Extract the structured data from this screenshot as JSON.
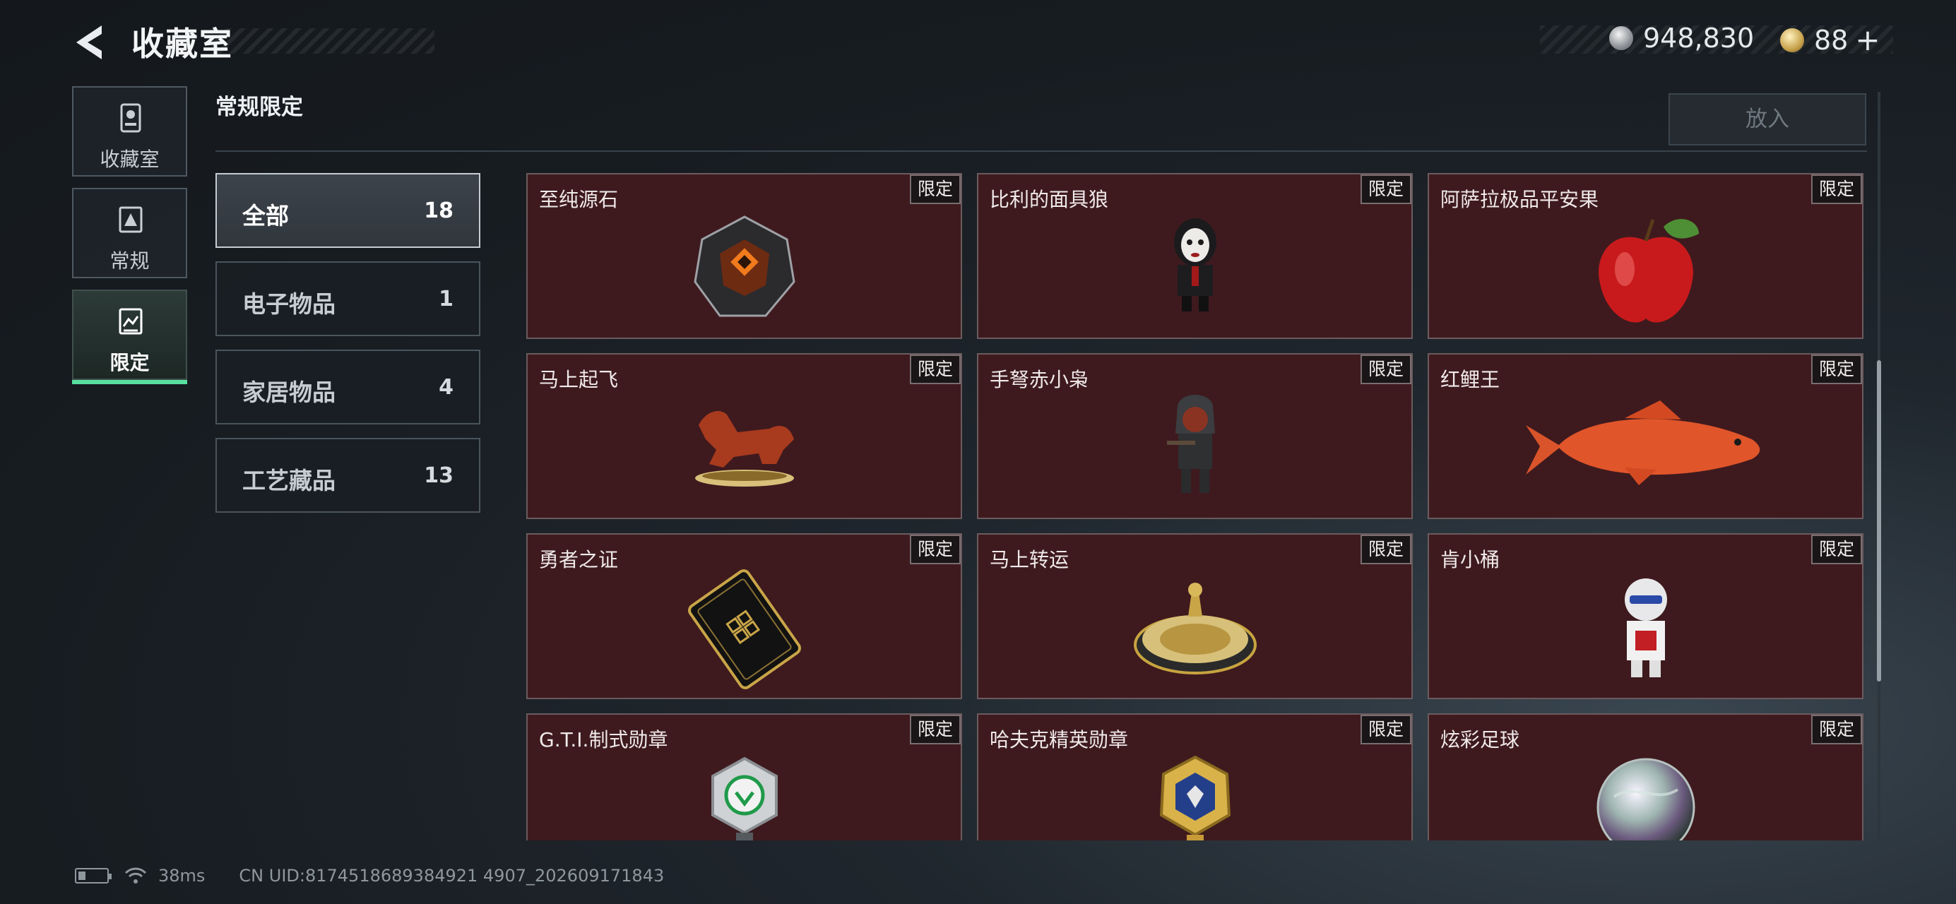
{
  "header": {
    "title": "收藏室",
    "currency_silver": "948,830",
    "currency_gold": "88",
    "gold_add": "+"
  },
  "nav": {
    "items": [
      {
        "label": "收藏室",
        "icon": "collection-room-icon"
      },
      {
        "label": "常规",
        "icon": "regular-icon"
      },
      {
        "label": "限定",
        "icon": "limited-icon",
        "active": true
      }
    ]
  },
  "section": {
    "title": "常规限定",
    "put_button": "放入"
  },
  "categories": [
    {
      "label": "全部",
      "count": "18",
      "active": true
    },
    {
      "label": "电子物品",
      "count": "1"
    },
    {
      "label": "家居物品",
      "count": "4"
    },
    {
      "label": "工艺藏品",
      "count": "13"
    }
  ],
  "items": [
    {
      "name": "至纯源石",
      "badge": "限定",
      "icon": "gem-icon"
    },
    {
      "name": "比利的面具狼",
      "badge": "限定",
      "icon": "puppet-figure-icon"
    },
    {
      "name": "阿萨拉极品平安果",
      "badge": "限定",
      "icon": "apple-icon"
    },
    {
      "name": "马上起飞",
      "badge": "限定",
      "icon": "horse-statue-icon"
    },
    {
      "name": "手弩赤小枭",
      "badge": "限定",
      "icon": "crossbow-figure-icon"
    },
    {
      "name": "红鲤王",
      "badge": "限定",
      "icon": "carp-icon"
    },
    {
      "name": "勇者之证",
      "badge": "限定",
      "icon": "card-icon"
    },
    {
      "name": "马上转运",
      "badge": "限定",
      "icon": "fortune-wheel-icon"
    },
    {
      "name": "肯小桶",
      "badge": "限定",
      "icon": "mascot-figure-icon"
    },
    {
      "name": "G.T.I.制式勋章",
      "badge": "限定",
      "icon": "medal-silver-icon"
    },
    {
      "name": "哈夫克精英勋章",
      "badge": "限定",
      "icon": "medal-gold-icon"
    },
    {
      "name": "炫彩足球",
      "badge": "限定",
      "icon": "iridescent-ball-icon"
    }
  ],
  "footer": {
    "ping": "38ms",
    "uid": "CN UID:8174518689384921 4907_202609171843"
  },
  "colors": {
    "card_bg": "#3e1a1e",
    "active_tab_accent": "#57e0a0"
  }
}
